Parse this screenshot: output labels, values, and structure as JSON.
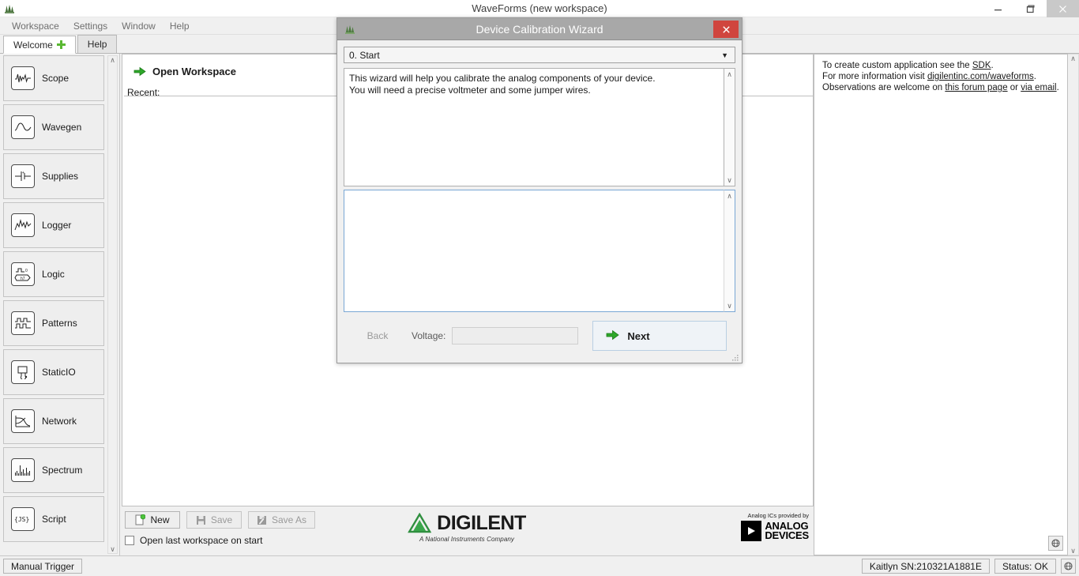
{
  "window": {
    "title": "WaveForms  (new workspace)",
    "app_icon": "waveforms-logo-icon",
    "minimize_label": "–",
    "maximize_label": "❐",
    "close_label": "×"
  },
  "menubar": {
    "items": [
      {
        "label": "Workspace"
      },
      {
        "label": "Settings"
      },
      {
        "label": "Window"
      },
      {
        "label": "Help"
      }
    ]
  },
  "tabs": [
    {
      "label": "Welcome",
      "active": true,
      "has_plus": true
    },
    {
      "label": "Help",
      "active": false,
      "has_plus": false
    }
  ],
  "sidebar": {
    "items": [
      {
        "label": "Scope",
        "icon": "waveform-scope-icon"
      },
      {
        "label": "Wavegen",
        "icon": "sine-wave-icon"
      },
      {
        "label": "Supplies",
        "icon": "battery-supply-icon"
      },
      {
        "label": "Logger",
        "icon": "logger-chart-icon"
      },
      {
        "label": "Logic",
        "icon": "logic-analyzer-icon"
      },
      {
        "label": "Patterns",
        "icon": "digital-pattern-icon"
      },
      {
        "label": "StaticIO",
        "icon": "static-io-icon"
      },
      {
        "label": "Network",
        "icon": "network-bode-icon"
      },
      {
        "label": "Spectrum",
        "icon": "spectrum-bars-icon"
      },
      {
        "label": "Script",
        "icon": "script-js-icon"
      }
    ],
    "scroll_up": "∧",
    "scroll_down": "∨"
  },
  "workspace": {
    "open_label": "Open Workspace",
    "open_icon": "green-arrow-icon",
    "recent_label": "Recent:",
    "buttons": [
      {
        "label": "New",
        "icon": "new-document-icon",
        "disabled": false
      },
      {
        "label": "Save",
        "icon": "floppy-save-icon",
        "disabled": true
      },
      {
        "label": "Save As",
        "icon": "floppy-save-as-icon",
        "disabled": true
      }
    ],
    "checkbox_label": "Open last workspace on start",
    "checkbox_checked": false
  },
  "branding": {
    "digilent_name": "DIGILENT",
    "digilent_tagline": "A National Instruments Company",
    "adi_top": "Analog ICs provided by",
    "adi_line1": "ANALOG",
    "adi_line2": "DEVICES"
  },
  "info_panel": {
    "line1_pre": "To create custom application see the ",
    "line1_link": "SDK",
    "line1_post": ".",
    "line2_pre": "For more information visit ",
    "line2_link": "digilentinc.com/waveforms",
    "line2_post": ".",
    "line3_pre": "Observations are welcome on ",
    "line3_link1": "this forum page",
    "line3_mid": " or ",
    "line3_link2": "via email",
    "line3_post": ".",
    "icon": "refresh-globe-icon"
  },
  "dialog": {
    "title": "Device Calibration Wizard",
    "icon": "waveforms-logo-icon",
    "close_label": "×",
    "step_select": {
      "value": "0. Start",
      "caret": "▼"
    },
    "instructions": "This wizard will help you calibrate the analog components of your device.\nYou will need a precise voltmeter and some jumper wires.",
    "output_value": "",
    "footer": {
      "back_label": "Back",
      "back_disabled": true,
      "voltage_label": "Voltage:",
      "voltage_value": "",
      "voltage_disabled": true,
      "next_label": "Next",
      "next_icon": "green-arrow-icon"
    },
    "scroll_up": "∧",
    "scroll_down": "∨"
  },
  "statusbar": {
    "manual_trigger": "Manual Trigger",
    "device": "Kaitlyn SN:210321A1881E",
    "status": "Status: OK",
    "icon": "device-settings-icon"
  },
  "colors": {
    "accent_green": "#3aa02c",
    "close_red": "#d0453e",
    "dialog_title_bg": "#a8a8a8",
    "focus_blue": "#7aa7d4",
    "window_bg": "#f0f0f0"
  }
}
